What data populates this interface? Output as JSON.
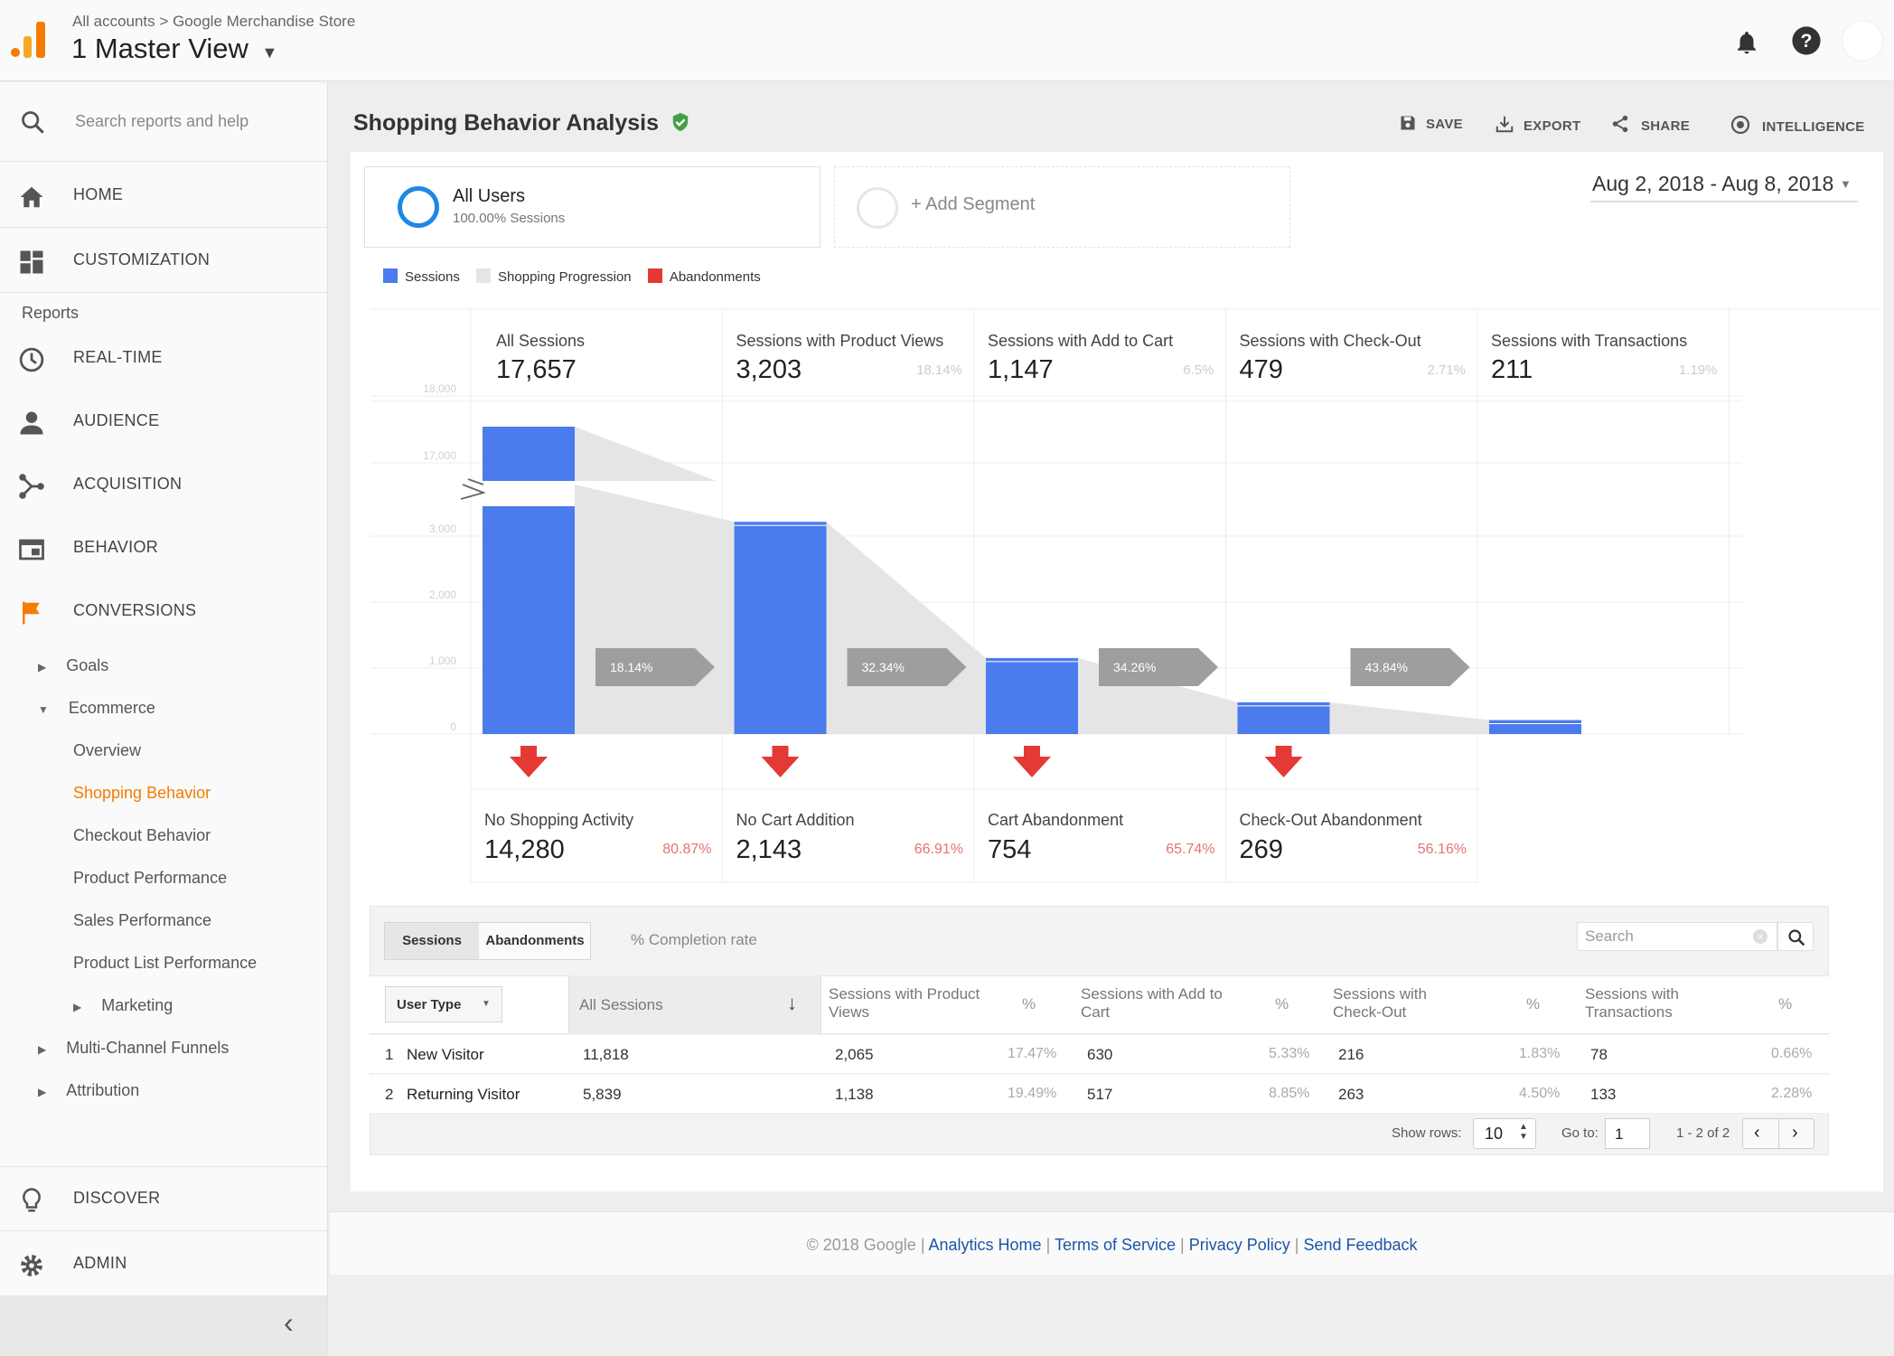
{
  "header": {
    "breadcrumb_root": "All accounts",
    "breadcrumb_sep": ">",
    "breadcrumb_child": "Google Merchandise Store",
    "view_name": "1 Master View",
    "icons": [
      "bell-icon",
      "help-icon",
      "avatar"
    ]
  },
  "sidebar": {
    "search_placeholder": "Search reports and help",
    "home": "HOME",
    "customization": "CUSTOMIZATION",
    "reports_label": "Reports",
    "realtime": "REAL-TIME",
    "audience": "AUDIENCE",
    "acquisition": "ACQUISITION",
    "behavior": "BEHAVIOR",
    "conversions": "CONVERSIONS",
    "goals": "Goals",
    "ecommerce": "Ecommerce",
    "overview": "Overview",
    "shopping_behavior": "Shopping Behavior",
    "checkout_behavior": "Checkout Behavior",
    "product_performance": "Product Performance",
    "sales_performance": "Sales Performance",
    "product_list_performance": "Product List Performance",
    "marketing": "Marketing",
    "multichannel": "Multi-Channel Funnels",
    "attribution": "Attribution",
    "discover": "DISCOVER",
    "admin": "ADMIN",
    "collapse_glyph": "‹",
    "active_color": "#f57c00"
  },
  "report": {
    "title": "Shopping Behavior Analysis",
    "save": "SAVE",
    "export": "EXPORT",
    "share": "SHARE",
    "intelligence": "INTELLIGENCE",
    "date_range": "Aug 2, 2018 - Aug 8, 2018",
    "segment_name": "All Users",
    "segment_sub": "100.00% Sessions",
    "add_segment": "+ Add Segment",
    "legend": [
      {
        "label": "Sessions",
        "color": "#4b7bec"
      },
      {
        "label": "Shopping Progression",
        "color": "#e5e5e5"
      },
      {
        "label": "Abandonments",
        "color": "#e53935"
      }
    ]
  },
  "chart_data": {
    "type": "bar",
    "categories": [
      "All Sessions",
      "Sessions with Product Views",
      "Sessions with Add to Cart",
      "Sessions with Check-Out",
      "Sessions with Transactions"
    ],
    "values": [
      17657,
      3203,
      1147,
      479,
      211
    ],
    "value_labels": [
      "17,657",
      "3,203",
      "1,147",
      "479",
      "211"
    ],
    "share_labels": [
      "",
      "18.14%",
      "6.5%",
      "2.71%",
      "1.19%"
    ],
    "progression": [
      "18.14%",
      "32.34%",
      "34.26%",
      "43.84%"
    ],
    "ytick_labels": [
      "0",
      "1,000",
      "2,000",
      "3,000",
      "17,000",
      "18,000"
    ],
    "axis_break": true,
    "abandonments": [
      {
        "label": "No Shopping Activity",
        "value": "14,280",
        "pct": "80.87%"
      },
      {
        "label": "No Cart Addition",
        "value": "2,143",
        "pct": "66.91%"
      },
      {
        "label": "Cart Abandonment",
        "value": "754",
        "pct": "65.74%"
      },
      {
        "label": "Check-Out Abandonment",
        "value": "269",
        "pct": "56.16%"
      }
    ],
    "colors": {
      "bar": "#4b7bec",
      "progress": "#9e9e9e",
      "abandon": "#e53935"
    }
  },
  "table": {
    "tabs": [
      "Sessions",
      "Abandonments"
    ],
    "completion_label": "% Completion rate",
    "search_placeholder": "Search",
    "dimension": "User Type",
    "columns": [
      "All Sessions",
      "Sessions with Product Views",
      "%",
      "Sessions with Add to Cart",
      "%",
      "Sessions with Check-Out",
      "%",
      "Sessions with Transactions",
      "%"
    ],
    "rows": [
      {
        "idx": "1",
        "type": "New Visitor",
        "all": "11,818",
        "pv": "2,065",
        "pv_pct": "17.47%",
        "atc": "630",
        "atc_pct": "5.33%",
        "co": "216",
        "co_pct": "1.83%",
        "tx": "78",
        "tx_pct": "0.66%"
      },
      {
        "idx": "2",
        "type": "Returning Visitor",
        "all": "5,839",
        "pv": "1,138",
        "pv_pct": "19.49%",
        "atc": "517",
        "atc_pct": "8.85%",
        "co": "263",
        "co_pct": "4.50%",
        "tx": "133",
        "tx_pct": "2.28%"
      }
    ],
    "show_rows_label": "Show rows:",
    "show_rows_value": "10",
    "goto_label": "Go to:",
    "goto_value": "1",
    "range": "1 - 2 of 2"
  },
  "footer": {
    "copyright": "© 2018 Google",
    "sep": "|",
    "analytics_home": "Analytics Home",
    "terms": "Terms of Service",
    "privacy": "Privacy Policy",
    "feedback": "Send Feedback"
  }
}
